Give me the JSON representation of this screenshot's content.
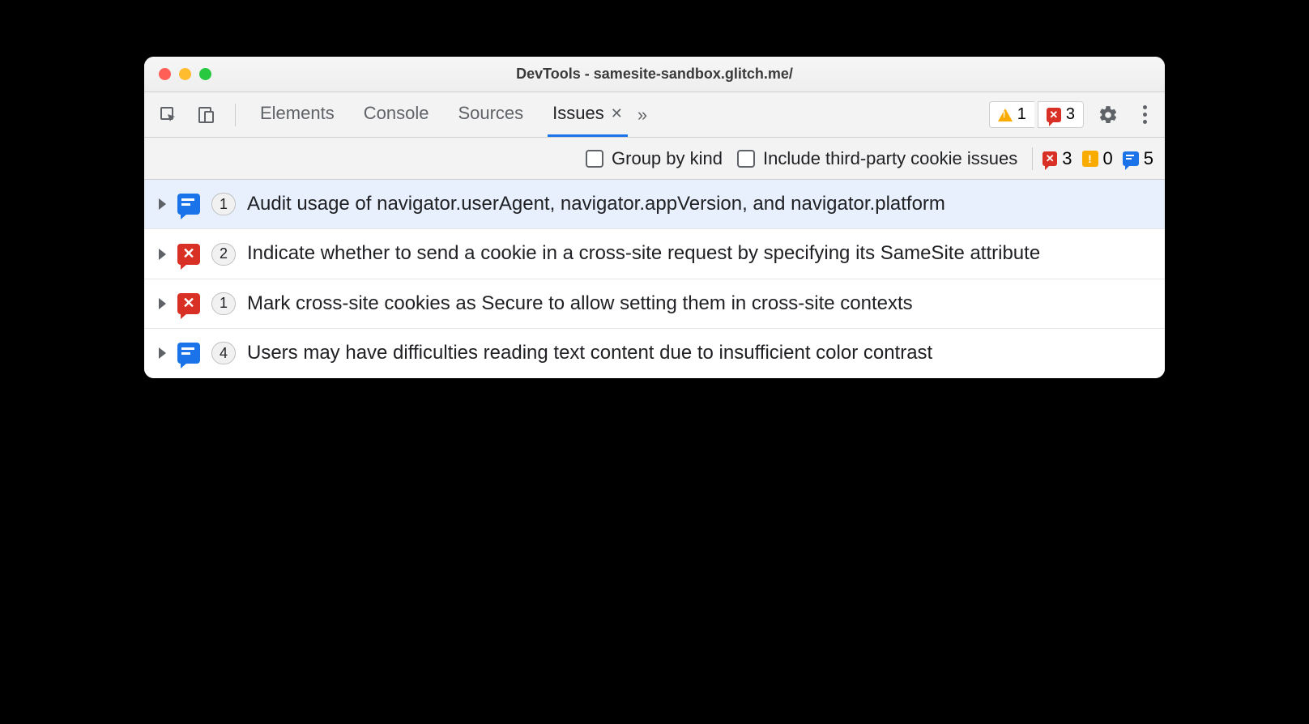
{
  "window": {
    "title": "DevTools - samesite-sandbox.glitch.me/"
  },
  "toolbar": {
    "tabs": [
      {
        "label": "Elements",
        "active": false
      },
      {
        "label": "Console",
        "active": false
      },
      {
        "label": "Sources",
        "active": false
      },
      {
        "label": "Issues",
        "active": true
      }
    ],
    "warnings_count": "1",
    "errors_count": "3"
  },
  "filterbar": {
    "group_by_kind_label": "Group by kind",
    "include_third_party_label": "Include third-party cookie issues",
    "errors_count": "3",
    "warnings_count": "0",
    "info_count": "5"
  },
  "issues": [
    {
      "type": "info",
      "count": "1",
      "selected": true,
      "title": "Audit usage of navigator.userAgent, navigator.appVersion, and navigator.platform"
    },
    {
      "type": "error",
      "count": "2",
      "selected": false,
      "title": "Indicate whether to send a cookie in a cross-site request by specifying its SameSite attribute"
    },
    {
      "type": "error",
      "count": "1",
      "selected": false,
      "title": "Mark cross-site cookies as Secure to allow setting them in cross-site contexts"
    },
    {
      "type": "info",
      "count": "4",
      "selected": false,
      "title": "Users may have difficulties reading text content due to insufficient color contrast"
    }
  ]
}
